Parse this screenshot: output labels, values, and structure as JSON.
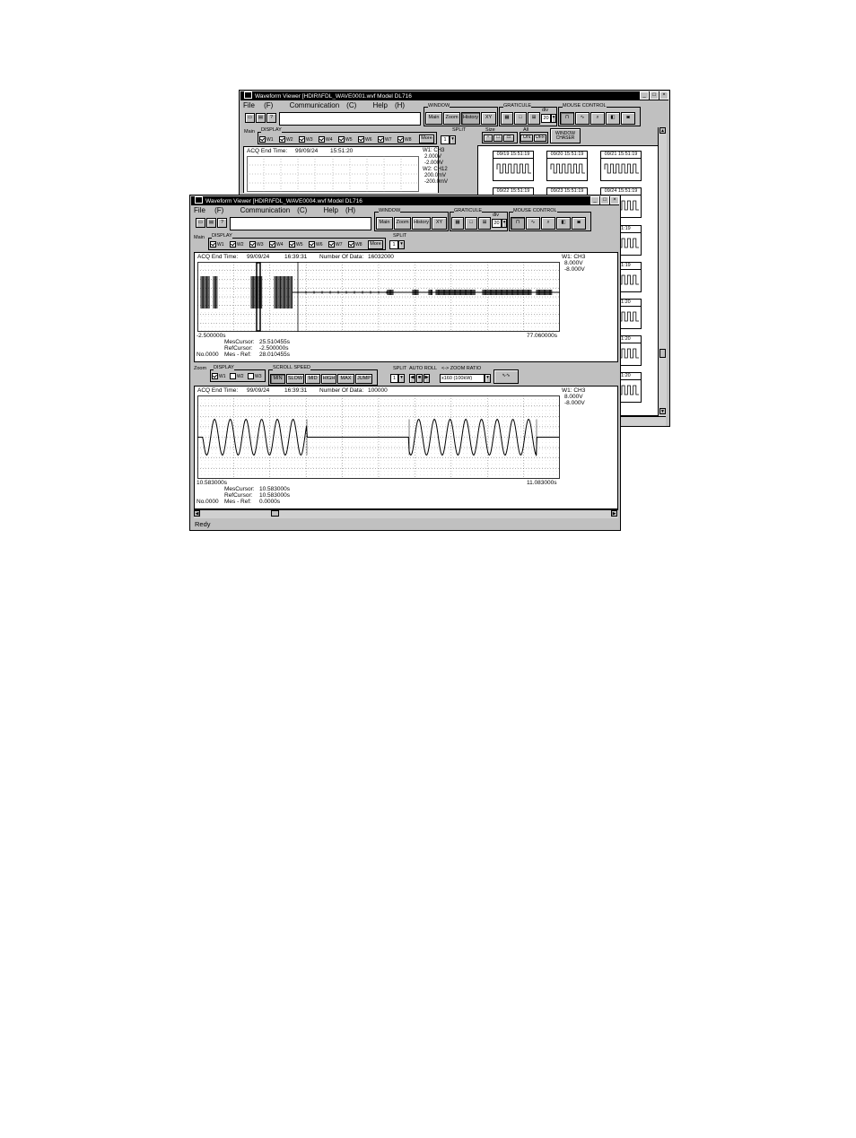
{
  "back_window": {
    "title": "Waveform Viewer  [HDIRI\\FDL_WAVE0001.wvf    Model  DL716",
    "title_buttons": [
      "_",
      "□",
      "×"
    ],
    "menu": [
      "File",
      "Communication",
      "Help"
    ],
    "menu_keys": [
      "(F)",
      "(C)",
      "(H)"
    ],
    "window_group_label": "WINDOW",
    "window_buttons": [
      "Main",
      "Zoom",
      "History",
      "XY"
    ],
    "graticule_label": "GRATICULE",
    "div_label": "div",
    "div_value": "20",
    "mouse_control_label": "MOUSE CONTROL",
    "display_panel": {
      "tag": "Main",
      "display_label": "DISPLAY",
      "channels": [
        "W1",
        "W2",
        "W3",
        "W4",
        "W5",
        "W6",
        "W7",
        "W8"
      ],
      "checked": [
        true,
        true,
        true,
        true,
        true,
        true,
        true,
        true
      ],
      "more_label": "More",
      "split_label": "SPLIT",
      "split_value": "1"
    },
    "acq_end_time_label": "ACQ End Time:",
    "acq_date": "99/09/24",
    "acq_time": "15:51:20",
    "readout": [
      "W1:  CH3",
      "2.000V",
      "-2.000V",
      "W2:  CH12",
      "200.0mV",
      "-200.0mV"
    ],
    "history_panel": {
      "size_label": "Size",
      "all_label": "All",
      "on_label": "ON",
      "off_label": "OFF",
      "window_chaser_label": "WINDOW CHASER",
      "thumbs_row1": [
        "09/19 15:51:19",
        "09/20 15:51:19",
        "09/21 15:51:19"
      ],
      "thumbs_row2": [
        "09/22 15:51:19",
        "09/23 15:51:19",
        "09/24 15:51:19"
      ],
      "right_col": [
        "15:51:19",
        "15:51:19",
        "15:51:20",
        "15:51:20",
        "15:51:20"
      ]
    }
  },
  "front_window": {
    "title": "Waveform Viewer  [HDIRI\\FDL_WAVE0004.wvf    Model  DL716",
    "title_buttons": [
      "_",
      "□",
      "×"
    ],
    "menu": [
      "File",
      "Communication",
      "Help"
    ],
    "menu_keys": [
      "(F)",
      "(C)",
      "(H)"
    ],
    "window_group_label": "WINDOW",
    "window_buttons": [
      "Main",
      "Zoom",
      "History",
      "XY"
    ],
    "graticule_label": "GRATICULE",
    "div_label": "div",
    "div_value": "20",
    "mouse_control_label": "MOUSE CONTROL",
    "main_panel": {
      "tag": "Main",
      "display_label": "DISPLAY",
      "channels": [
        "W1",
        "W2",
        "W3",
        "W4",
        "W5",
        "W6",
        "W7",
        "W8"
      ],
      "checked": [
        true,
        true,
        true,
        true,
        true,
        true,
        true,
        true
      ],
      "more_label": "More",
      "split_label": "SPLIT",
      "split_value": "1",
      "acq_end_time_label": "ACQ End Time:",
      "acq_date": "99/09/24",
      "acq_time": "16:39:31",
      "num_data_label": "Number Of Data:",
      "num_data": "16032000",
      "readout": [
        "W1:  CH3",
        "8.000V",
        "-8.000V"
      ],
      "x_start": "-2.500000s",
      "x_end": "77.060000s",
      "mes_cursor_label": "MesCursor:",
      "mes_cursor": "25.510455s",
      "ref_cursor_label": "RefCursor:",
      "ref_cursor": "-2.500000s",
      "no_label": "No.0000",
      "mes_ref_label": "Mes - Ref:",
      "mes_ref": "28.010455s"
    },
    "zoom_panel": {
      "tag": "Zoom",
      "display_label": "DISPLAY",
      "channels": [
        "W1",
        "W2",
        "W3"
      ],
      "checked": [
        true,
        false,
        false
      ],
      "scroll_speed_label": "SCROLL SPEED",
      "speed_buttons": [
        "MIN",
        "SLOW",
        "MID",
        "HIGH",
        "MAX",
        "JUMP"
      ],
      "split_label": "SPLIT",
      "split_value": "1",
      "auto_roll_label": "AUTO ROLL",
      "zoom_ratio_label": "<-> ZOOM RATIO",
      "zoom_ratio_value": "x160 (100kW)",
      "acq_end_time_label": "ACQ End Time:",
      "acq_date": "99/09/24",
      "acq_time": "16:39:31",
      "num_data_label": "Number Of Data:",
      "num_data": "100000",
      "readout": [
        "W1:  CH3",
        "8.000V",
        "-8.000V"
      ],
      "x_start": "10.583000s",
      "x_end": "11.083000s",
      "mes_cursor_label": "MesCursor:",
      "mes_cursor": "10.583000s",
      "ref_cursor_label": "RefCursor:",
      "ref_cursor": "10.583000s",
      "no_label": "No.0000",
      "mes_ref_label": "Mes - Ref:",
      "mes_ref": "0.0000s"
    },
    "status": "Redy"
  }
}
